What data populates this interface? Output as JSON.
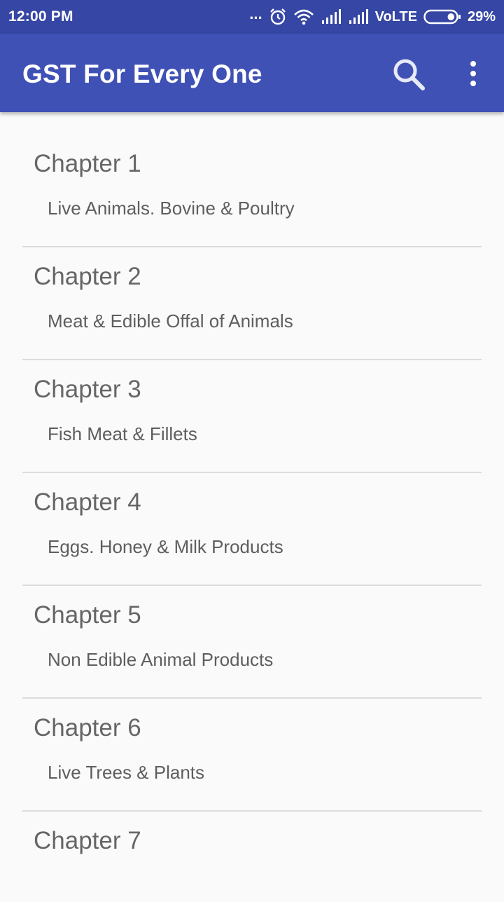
{
  "status_bar": {
    "time": "12:00 PM",
    "dots": "...",
    "network_label": "VoLTE",
    "battery_percent": "29%",
    "battery_level": 0.29
  },
  "app_bar": {
    "title": "GST For Every One",
    "icons": [
      "search-icon",
      "more-vert-icon"
    ]
  },
  "chapters": [
    {
      "title": "Chapter 1",
      "subtitle": "Live Animals. Bovine & Poultry"
    },
    {
      "title": "Chapter 2",
      "subtitle": "Meat & Edible Offal of Animals"
    },
    {
      "title": "Chapter 3",
      "subtitle": "Fish Meat & Fillets"
    },
    {
      "title": "Chapter 4",
      "subtitle": "Eggs. Honey & Milk Products"
    },
    {
      "title": "Chapter 5",
      "subtitle": "Non Edible Animal Products"
    },
    {
      "title": "Chapter 6",
      "subtitle": "Live Trees & Plants"
    },
    {
      "title": "Chapter 7",
      "subtitle": ""
    }
  ],
  "colors": {
    "status_bar": "#3646a4",
    "app_bar": "#3f51b5",
    "background": "#fafafa",
    "title_text": "#666666",
    "subtitle_text": "#5e5e5e"
  }
}
